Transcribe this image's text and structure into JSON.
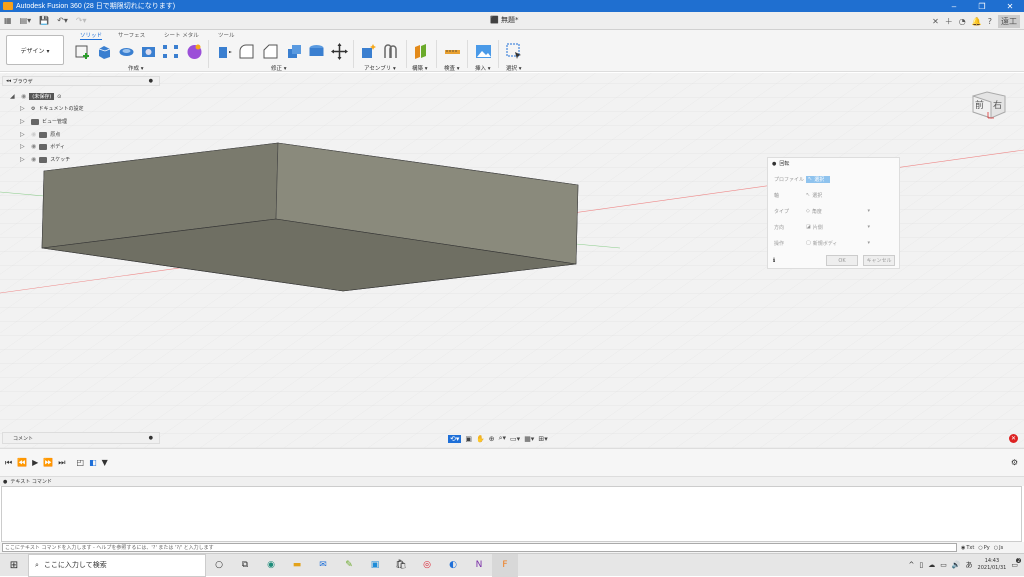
{
  "window": {
    "title": "Autodesk Fusion 360 (28 日で期限切れになります)"
  },
  "doc_tab": {
    "title": "無題*"
  },
  "user": {
    "initials": "遠工"
  },
  "design_button": {
    "label": "デザイン ▾"
  },
  "workspace_tabs": [
    "ソリッド",
    "サーフェス",
    "シート メタル",
    "ツール"
  ],
  "tool_groups": [
    {
      "name": "create",
      "label": "作成 ▾"
    },
    {
      "name": "modify",
      "label": "修正 ▾"
    },
    {
      "name": "assemble",
      "label": "アセンブリ ▾"
    },
    {
      "name": "construct",
      "label": "構築 ▾"
    },
    {
      "name": "inspect",
      "label": "検査 ▾"
    },
    {
      "name": "insert",
      "label": "挿入 ▾"
    },
    {
      "name": "select",
      "label": "選択 ▾"
    }
  ],
  "browser": {
    "header": "ブラウザ",
    "root": "(未保存)",
    "items": [
      "ドキュメントの設定",
      "ビュー管理",
      "原点",
      "ボディ",
      "スケッチ"
    ]
  },
  "viewcube": {
    "front": "前",
    "right": "右"
  },
  "rotate_panel": {
    "title": "回転",
    "rows": [
      {
        "label": "プロファイル",
        "value": "選択"
      },
      {
        "label": "軸",
        "value": "選択"
      },
      {
        "label": "タイプ",
        "value": "角度"
      },
      {
        "label": "方向",
        "value": "片側"
      },
      {
        "label": "操作",
        "value": "新規ボディ"
      }
    ],
    "ok": "OK",
    "cancel": "キャンセル"
  },
  "comments": {
    "label": "コメント"
  },
  "text_command": {
    "header": "テキスト コマンド",
    "placeholder": "ここにテキスト コマンドを入力します - ヘルプを参照するには、'?' または '?/' と入力します",
    "modes": [
      "Txt",
      "Py",
      "Js"
    ]
  },
  "taskbar": {
    "search": "ここに入力して検索",
    "time": "14:43",
    "date": "2021/01/31",
    "notification_count": "2"
  },
  "colors": {
    "titlebar": "#1f6fd0",
    "accent": "#1e6fd8",
    "body_fill": "#6a6a5e"
  }
}
